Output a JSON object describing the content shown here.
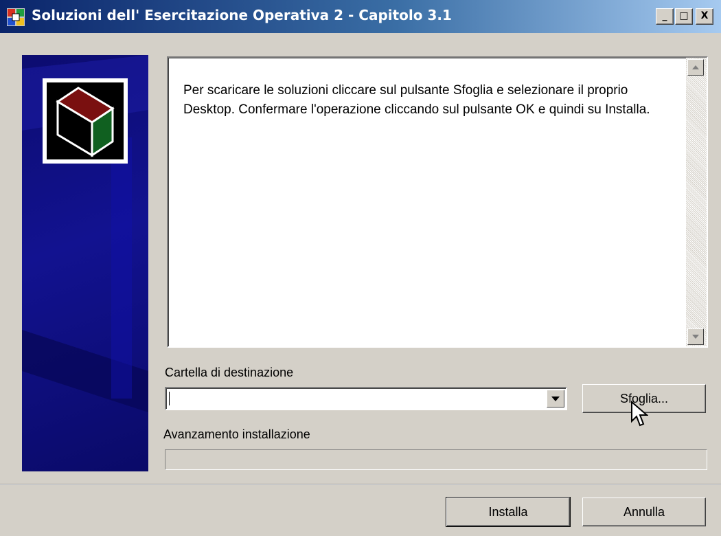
{
  "window": {
    "title": "Soluzioni dell' Esercitazione Operativa 2 - Capitolo 3.1",
    "controls": {
      "minimize": "_",
      "maximize": "□",
      "close": "X"
    },
    "title_icon": "installer-app-icon"
  },
  "banner": {
    "logo_icon": "box-package-icon"
  },
  "message": {
    "text": "Per scaricare le soluzioni cliccare sul pulsante Sfoglia e selezionare il proprio Desktop. Confermare l'operazione cliccando sul pulsante OK e quindi su Installa."
  },
  "destination": {
    "label": "Cartella di destinazione",
    "value": "",
    "browse_label": "Sfoglia..."
  },
  "progress": {
    "label": "Avanzamento installazione",
    "percent": 0
  },
  "footer": {
    "install_label": "Installa",
    "cancel_label": "Annulla"
  },
  "colors": {
    "titlebar_start": "#0a246a",
    "titlebar_end": "#a6caf0",
    "banner": "#0c0c70",
    "face": "#d4d0c8"
  }
}
